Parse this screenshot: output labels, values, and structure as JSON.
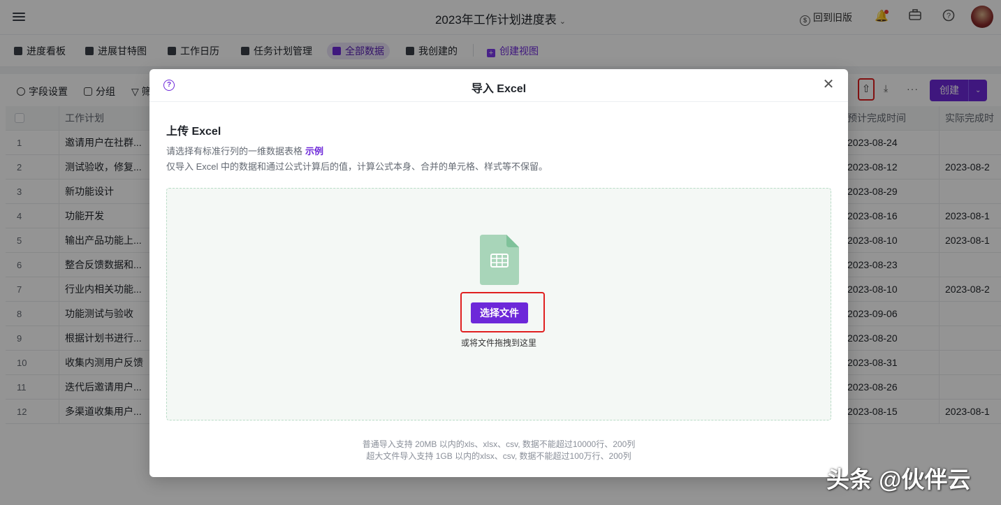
{
  "topbar": {
    "title": "2023年工作计划进度表",
    "old_version": "回到旧版"
  },
  "views": {
    "tabs": [
      {
        "label": "进度看板"
      },
      {
        "label": "进展甘特图"
      },
      {
        "label": "工作日历"
      },
      {
        "label": "任务计划管理"
      },
      {
        "label": "全部数据",
        "active": true
      },
      {
        "label": "我创建的"
      }
    ],
    "create_view": "创建视图"
  },
  "toolbar": {
    "field_settings": "字段设置",
    "group": "分组",
    "filter_partial": "筛",
    "create": "创建"
  },
  "table": {
    "headers": {
      "work_plan": "工作计划",
      "planned_done": "预计完成时间",
      "actual_done": "实际完成时"
    },
    "rows": [
      {
        "no": "1",
        "plan": "邀请用户在社群...",
        "planned": "2023-08-24",
        "actual": ""
      },
      {
        "no": "2",
        "plan": "测试验收，修复...",
        "planned": "2023-08-12",
        "actual": "2023-08-2"
      },
      {
        "no": "3",
        "plan": "新功能设计",
        "planned": "2023-08-29",
        "actual": ""
      },
      {
        "no": "4",
        "plan": "功能开发",
        "planned": "2023-08-16",
        "actual": "2023-08-1"
      },
      {
        "no": "5",
        "plan": "输出产品功能上...",
        "planned": "2023-08-10",
        "actual": "2023-08-1"
      },
      {
        "no": "6",
        "plan": "整合反馈数据和...",
        "planned": "2023-08-23",
        "actual": ""
      },
      {
        "no": "7",
        "plan": "行业内相关功能...",
        "planned": "2023-08-10",
        "actual": "2023-08-2"
      },
      {
        "no": "8",
        "plan": "功能测试与验收",
        "planned": "2023-09-06",
        "actual": ""
      },
      {
        "no": "9",
        "plan": "根据计划书进行...",
        "planned": "2023-08-20",
        "actual": ""
      },
      {
        "no": "10",
        "plan": "收集内测用户反馈",
        "planned": "2023-08-31",
        "actual": ""
      },
      {
        "no": "11",
        "plan": "迭代后邀请用户...",
        "planned": "2023-08-26",
        "actual": ""
      },
      {
        "no": "12",
        "plan": "多渠道收集用户...",
        "planned": "2023-08-15",
        "actual": "2023-08-1"
      }
    ]
  },
  "modal": {
    "title": "导入 Excel",
    "heading": "上传 Excel",
    "desc1": "请选择有标准行列的一维数据表格",
    "example_link": "示例",
    "desc2": "仅导入 Excel 中的数据和通过公式计算后的值，计算公式本身、合并的单元格、样式等不保留。",
    "choose_file": "选择文件",
    "drag_hint": "或将文件拖拽到这里",
    "footnote1": "普通导入支持 20MB 以内的xls、xlsx、csv, 数据不能超过10000行、200列",
    "footnote2": "超大文件导入支持 1GB 以内的xlsx、csv, 数据不能超过100万行、200列"
  },
  "watermark": "头条 @伙伴云",
  "colors": {
    "accent": "#6d28d9",
    "highlight_border": "#e02020",
    "dropzone_bg": "#f4f8f5",
    "file_icon": "#a8d5b9"
  }
}
